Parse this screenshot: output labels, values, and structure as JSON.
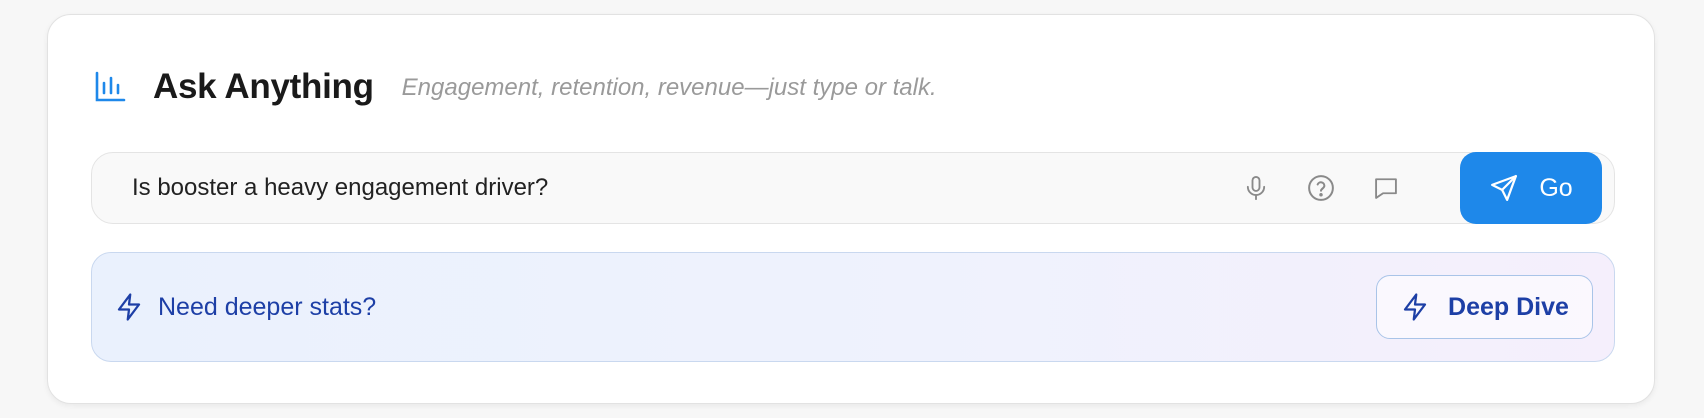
{
  "header": {
    "icon": "bar-chart-icon",
    "title": "Ask Anything",
    "subtitle": "Engagement, retention, revenue—just type or talk."
  },
  "search": {
    "value": "Is booster a heavy engagement driver?",
    "placeholder": "",
    "actions": [
      {
        "name": "microphone",
        "icon": "mic-icon"
      },
      {
        "name": "help",
        "icon": "help-circle-icon"
      },
      {
        "name": "chat",
        "icon": "message-icon"
      }
    ],
    "go_label": "Go",
    "go_icon": "send-icon"
  },
  "banner": {
    "icon": "lightning-icon",
    "text": "Need deeper stats?",
    "button_label": "Deep Dive",
    "button_icon": "lightning-icon"
  },
  "colors": {
    "accent": "#1e88ea",
    "banner_text": "#1d3fa6",
    "title": "#1a1a1a",
    "subtitle": "#9a9a9a"
  }
}
